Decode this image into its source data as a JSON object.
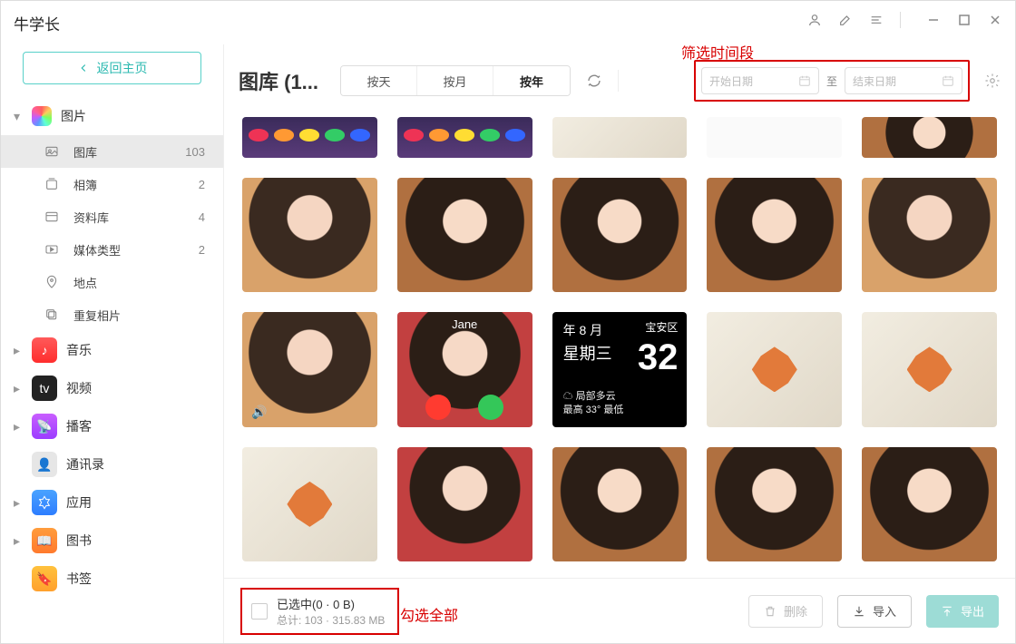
{
  "app": {
    "title": "牛学长"
  },
  "annotations": {
    "time_filter": "筛选时间段",
    "select_all": "勾选全部"
  },
  "sidebar": {
    "back_label": "返回主页",
    "groups": [
      {
        "id": "photos",
        "label": "图片",
        "expanded": true,
        "subs": [
          {
            "id": "library",
            "label": "图库",
            "count": "103",
            "active": true
          },
          {
            "id": "albums",
            "label": "相簿",
            "count": "2"
          },
          {
            "id": "datastore",
            "label": "资料库",
            "count": "4"
          },
          {
            "id": "mediatypes",
            "label": "媒体类型",
            "count": "2"
          },
          {
            "id": "places",
            "label": "地点",
            "count": ""
          },
          {
            "id": "duplicates",
            "label": "重复相片",
            "count": ""
          }
        ]
      },
      {
        "id": "music",
        "label": "音乐"
      },
      {
        "id": "video",
        "label": "视频"
      },
      {
        "id": "podcast",
        "label": "播客"
      },
      {
        "id": "contacts",
        "label": "通讯录",
        "no_caret": true
      },
      {
        "id": "apps",
        "label": "应用"
      },
      {
        "id": "books",
        "label": "图书"
      },
      {
        "id": "bookmarks",
        "label": "书签"
      }
    ]
  },
  "toolbar": {
    "title": "图库 (1...",
    "seg_day": "按天",
    "seg_month": "按月",
    "seg_year": "按年",
    "seg_active": "year",
    "date_start_placeholder": "开始日期",
    "date_to_label": "至",
    "date_end_placeholder": "结束日期"
  },
  "footer": {
    "selected_label": "已选中(0 · 0 B)",
    "total_label": "总计: 103 · 315.83 MB",
    "delete_label": "删除",
    "import_label": "导入",
    "export_label": "导出"
  },
  "thumbs": {
    "r1c2_name": "Jane",
    "weather": {
      "month": "年 8 月",
      "day": "星期三",
      "temp": "32",
      "region": "宝安区",
      "line1": "局部多云",
      "line2": "最高 33° 最低"
    }
  }
}
